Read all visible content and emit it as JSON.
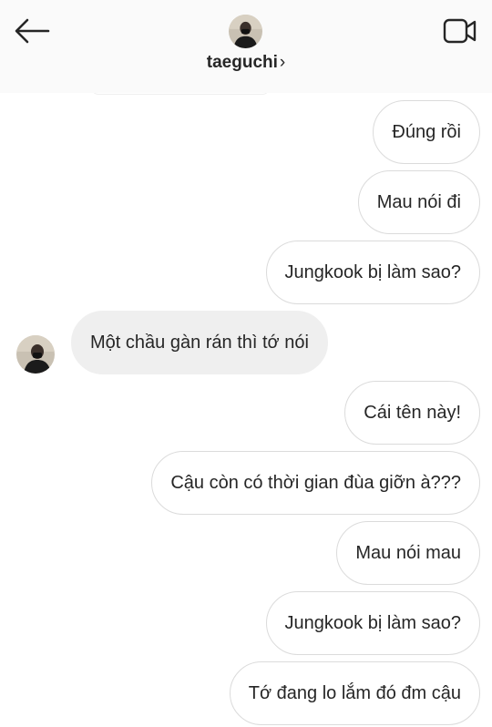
{
  "header": {
    "username": "taeguchi",
    "chevron": "›",
    "back_icon": "arrow-left",
    "video_icon": "video-camera"
  },
  "messages": [
    {
      "sender": "me",
      "text": "Đúng rồi"
    },
    {
      "sender": "me",
      "text": "Mau nói đi"
    },
    {
      "sender": "me",
      "text": "Jungkook bị làm sao?"
    },
    {
      "sender": "taeguchi",
      "text": "Một chầu gàn rán thì tớ nói"
    },
    {
      "sender": "me",
      "text": "Cái tên này!"
    },
    {
      "sender": "me",
      "text": "Cậu còn có thời gian đùa giỡn à???"
    },
    {
      "sender": "me",
      "text": "Mau nói mau"
    },
    {
      "sender": "me",
      "text": "Jungkook bị làm sao?"
    },
    {
      "sender": "me",
      "text": "Tớ đang lo lắm đó đm cậu"
    }
  ],
  "colors": {
    "header_bg": "#fafafa",
    "sent_border": "#dbdbdb",
    "received_bg": "#efefef",
    "text": "#262626"
  }
}
